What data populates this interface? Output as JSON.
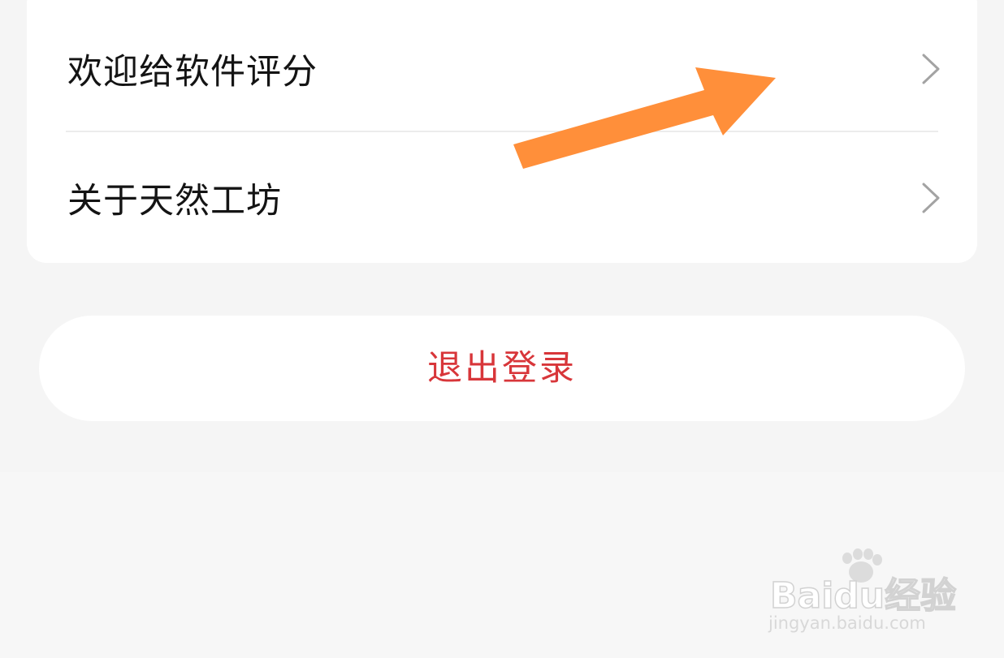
{
  "settings": {
    "items": [
      {
        "label": "欢迎给软件评分",
        "icon": "chevron-right-icon"
      },
      {
        "label": "关于天然工坊",
        "icon": "chevron-right-icon"
      }
    ]
  },
  "logout": {
    "label": "退出登录"
  },
  "watermark": {
    "brand": "Baidu经验",
    "url": "jingyan.baidu.com"
  },
  "colors": {
    "background": "#f5f5f5",
    "card": "#ffffff",
    "text": "#141414",
    "logout_text": "#d8363a",
    "chevron": "#a3a3a3",
    "annotation_arrow": "#ff8f3a"
  }
}
